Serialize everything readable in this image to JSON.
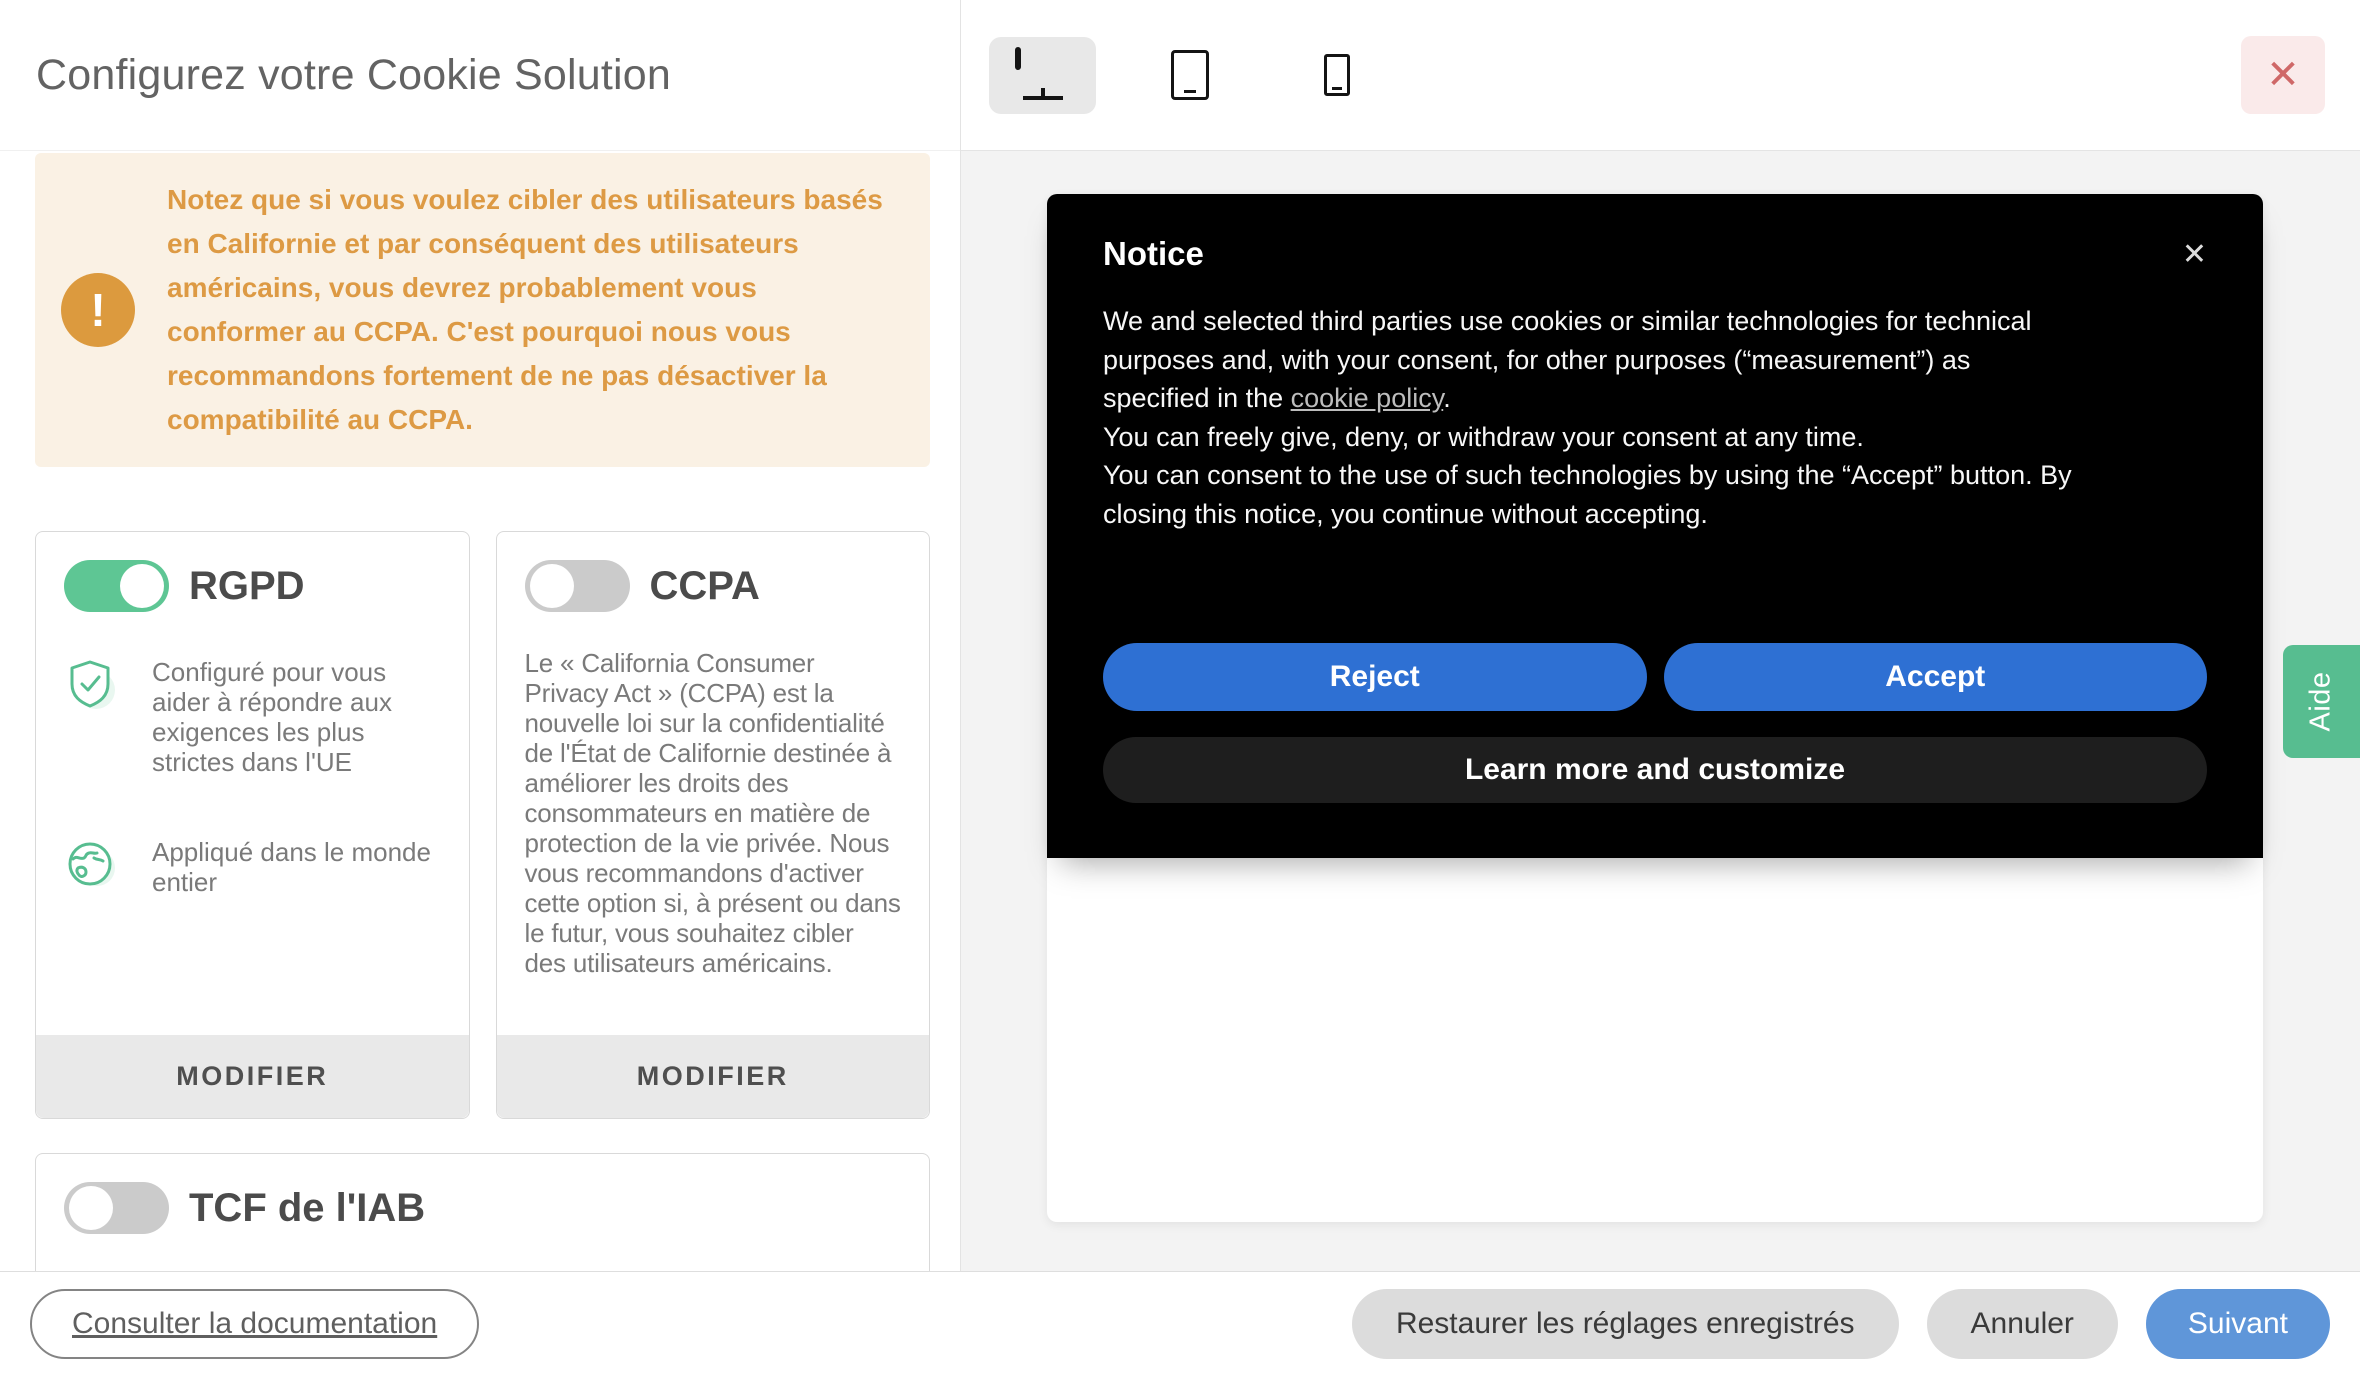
{
  "dialog": {
    "title": "Configurez votre Cookie Solution",
    "close_label": "✕"
  },
  "warning": {
    "icon": "exclamation-icon",
    "text": "Notez que si vous voulez cibler des utilisateurs basés en Californie et par conséquent des utilisateurs américains, vous devrez probablement vous conformer au CCPA. C'est pourquoi nous vous recommandons fortement de ne pas désactiver la compatibilité au CCPA."
  },
  "cards": {
    "rgpd": {
      "label": "RGPD",
      "toggle_state": "on",
      "features": [
        {
          "icon": "shield-check-icon",
          "text": "Configuré pour vous aider à répondre aux exigences les plus strictes dans l'UE"
        },
        {
          "icon": "globe-icon",
          "text": "Appliqué dans le monde entier"
        }
      ],
      "action_label": "MODIFIER"
    },
    "ccpa": {
      "label": "CCPA",
      "toggle_state": "off",
      "description": "Le « California Consumer Privacy Act » (CCPA) est la nouvelle loi sur la confidentialité de l'État de Californie destinée à améliorer les droits des consommateurs en matière de protection de la vie privée. Nous vous recommandons d'activer cette option si, à présent ou dans le futur, vous souhaitez cibler des utilisateurs américains.",
      "action_label": "MODIFIER"
    },
    "tcf": {
      "label": "TCF de l'IAB",
      "toggle_state": "off"
    }
  },
  "preview": {
    "device_tabs": [
      {
        "name": "desktop",
        "selected": true
      },
      {
        "name": "tablet",
        "selected": false
      },
      {
        "name": "mobile",
        "selected": false
      }
    ],
    "notice": {
      "title": "Notice",
      "close_label": "✕",
      "lines": {
        "l1": "We and selected third parties use cookies or similar technologies for technical",
        "l2": "purposes and, with your consent, for other purposes (“measurement”) as",
        "l3_before": "specified in the ",
        "l3_link": "cookie policy",
        "l3_after": ".",
        "l4": "You can freely give, deny, or withdraw your consent at any time.",
        "l5": "You can consent to the use of such technologies by using the “Accept” button. By",
        "l6": "closing this notice, you continue without accepting."
      },
      "buttons": {
        "reject": "Reject",
        "accept": "Accept",
        "learn_more": "Learn more and customize"
      }
    }
  },
  "help_tab": {
    "label": "Aide"
  },
  "footer": {
    "documentation": "Consulter la documentation",
    "restore": "Restaurer les réglages enregistrés",
    "cancel": "Annuler",
    "next": "Suivant"
  },
  "colors": {
    "accent_green": "#5ec694",
    "help_green": "#57bd90",
    "warning_orange": "#dd9a44",
    "warning_bg": "#faf1e4",
    "primary_blue": "#2e70d3",
    "next_blue": "#5f96d9",
    "close_pink_bg": "#faeaea",
    "close_pink_x": "#cf6868",
    "notice_bg": "#000000"
  }
}
